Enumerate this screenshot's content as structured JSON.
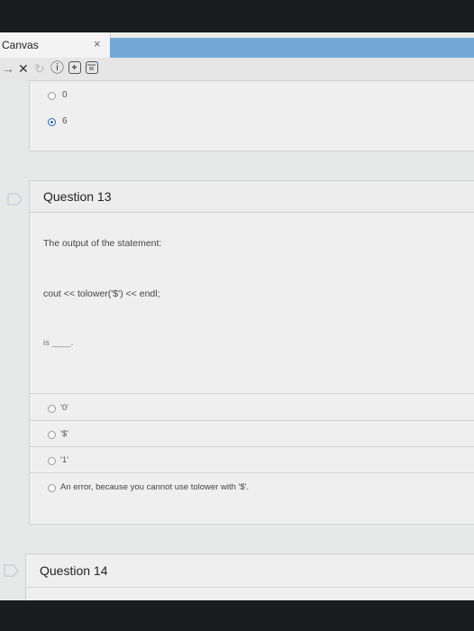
{
  "browser": {
    "tab_title": "Canvas",
    "tab_close": "×",
    "nav_back": "→",
    "nav_close": "✕",
    "nav_refresh": "↻",
    "info_icon": "ⓘ"
  },
  "prev_question": {
    "options": [
      {
        "label": "0",
        "selected": false
      },
      {
        "label": "6",
        "selected": true
      }
    ]
  },
  "question13": {
    "title": "Question 13",
    "prompt": "The output of the statement:",
    "code": "cout << tolower('$') << endl;",
    "suffix": "is ____.",
    "options": [
      {
        "label": "'0'"
      },
      {
        "label": "'$'"
      },
      {
        "label": "'1'"
      },
      {
        "label": "An error, because you cannot use tolower with '$'."
      }
    ]
  },
  "question14": {
    "title": "Question 14"
  },
  "colors": {
    "accent": "#2e6fb7",
    "tab_accent": "#74a9d6",
    "background": "#e7e8e8"
  }
}
